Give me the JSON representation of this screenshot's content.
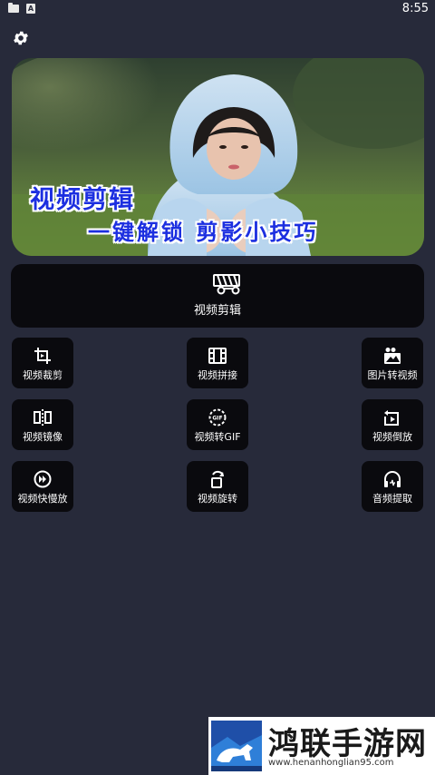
{
  "status_bar": {
    "time": "8:55",
    "icon2_letter": "A",
    "icons": [
      "folder-icon",
      "a-icon"
    ]
  },
  "header": {
    "settings_icon": "gear-icon"
  },
  "banner": {
    "title": "视频剪辑",
    "subtitle": "一键解锁 剪影小技巧",
    "colors": {
      "text": "#1c2fe0",
      "outline": "#ffffff"
    }
  },
  "main_action": {
    "label": "视频剪辑",
    "icon": "clapper-scissors-icon"
  },
  "tools": [
    {
      "label": "视频裁剪",
      "icon": "crop-icon"
    },
    {
      "label": "视频拼接",
      "icon": "film-icon"
    },
    {
      "label": "图片转视频",
      "icon": "image-video-icon"
    },
    {
      "label": "视频镜像",
      "icon": "mirror-icon"
    },
    {
      "label": "视频转GIF",
      "icon": "gif-icon"
    },
    {
      "label": "视频倒放",
      "icon": "reverse-icon"
    },
    {
      "label": "视频快慢放",
      "icon": "speed-icon"
    },
    {
      "label": "视频旋转",
      "icon": "rotate-icon"
    },
    {
      "label": "音频提取",
      "icon": "headphones-icon"
    }
  ],
  "watermark": {
    "title": "鸿联手游网",
    "url": "www.henanhonglian95.com"
  },
  "colors": {
    "background": "#272a3a",
    "tile": "#0a0a0e"
  }
}
